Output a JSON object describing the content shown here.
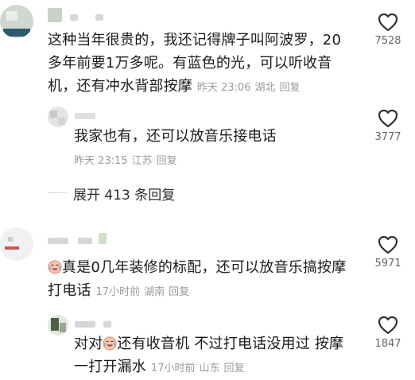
{
  "comments": [
    {
      "id": "c1",
      "lines": [
        "这种当年很贵的，我还记得牌子叫阿波罗，20",
        "多年前要1万多呢。有蓝色的光，可以听收音"
      ],
      "last_line": "机，还有冲水背部按摩",
      "time": "昨天 23:06",
      "location": "湖北",
      "reply_label": "回复",
      "likes": "7528"
    },
    {
      "id": "r1",
      "text": "我家也有，还可以放音乐接电话",
      "time": "昨天 23:15",
      "location": "江苏",
      "reply_label": "回复",
      "likes": "3777"
    },
    {
      "id": "c2",
      "text": "真是0几年装修的标配，还可以放音乐搞按摩",
      "last_line": "打电话",
      "time": "17小时前",
      "location": "湖南",
      "reply_label": "回复",
      "likes": "5971"
    },
    {
      "id": "r2",
      "text_before_emoji": "对对",
      "text_after_emoji": "还有收音机 不过打电话没用过 按摩",
      "last_line": "一打开漏水",
      "time": "17小时前",
      "location": "山东",
      "reply_label": "回复",
      "likes": "1847"
    }
  ],
  "expand_replies": "展开 413 条回复",
  "icons": {
    "like": "heart-outline-icon",
    "emoji": "crying-laughing-emoji"
  },
  "colors": {
    "text": "#1a1a1a",
    "meta": "#9a9a9a",
    "icon": "#333333"
  }
}
